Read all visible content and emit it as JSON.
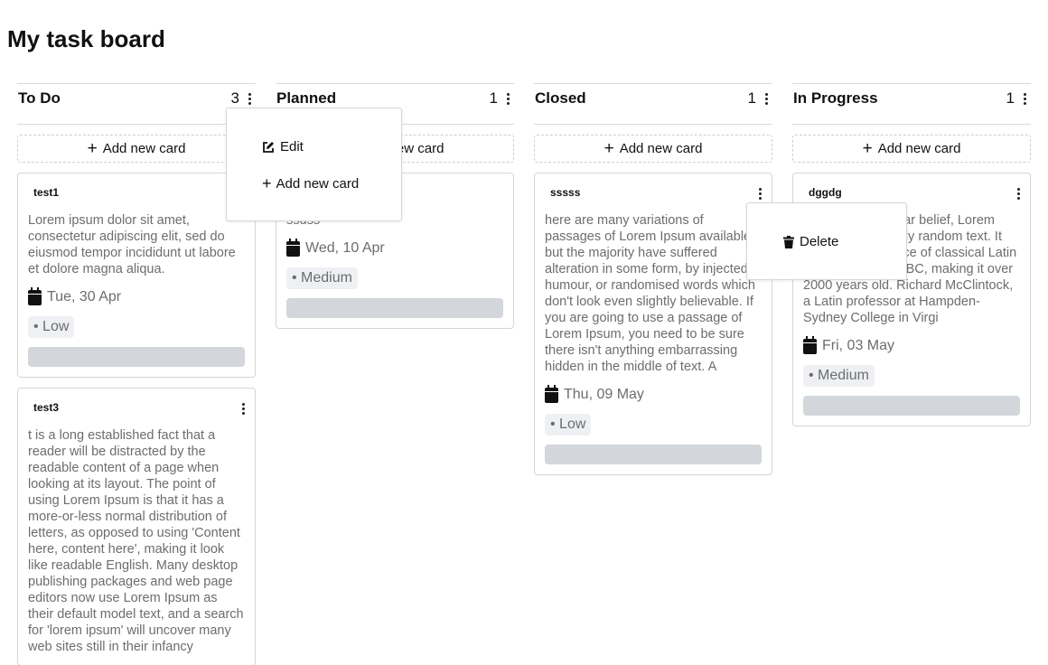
{
  "page": {
    "title": "My task board"
  },
  "columns": [
    {
      "title": "To Do",
      "count": "3",
      "add_label": "Add new card",
      "cards": [
        {
          "title": "test1",
          "description": "Lorem ipsum dolor sit amet, consectetur adipiscing elit, sed do eiusmod tempor incididunt ut labore et dolore magna aliqua.",
          "date": "Tue, 30 Apr",
          "priority": "• Low"
        },
        {
          "title": "test3",
          "description": "t is a long established fact that a reader will be distracted by the readable content of a page when looking at its layout. The point of using Lorem Ipsum is that it has a more-or-less normal distribution of letters, as opposed to using 'Content here, content here', making it look like readable English. Many desktop publishing packages and web page editors now use Lorem Ipsum as their default model text, and a search for 'lorem ipsum' will uncover many web sites still in their infancy"
        }
      ]
    },
    {
      "title": "Planned",
      "count": "1",
      "add_label": "Add new card",
      "cards": [
        {
          "title": "",
          "description": "ssdss",
          "date": "Wed, 10 Apr",
          "priority": "• Medium"
        }
      ]
    },
    {
      "title": "Closed",
      "count": "1",
      "add_label": "Add new card",
      "cards": [
        {
          "title": "sssss",
          "description": "here are many variations of passages of Lorem Ipsum available, but the majority have suffered alteration in some form, by injected humour, or randomised words which don't look even slightly believable. If you are going to use a passage of Lorem Ipsum, you need to be sure there isn't anything embarrassing hidden in the middle of text. A",
          "date": "Thu, 09 May",
          "priority": "• Low"
        }
      ]
    },
    {
      "title": "In Progress",
      "count": "1",
      "add_label": "Add new card",
      "cards": [
        {
          "title": "dggdg",
          "description": "Contrary to popular belief, Lorem Ipsum is not simply random text. It has roots in a piece of classical Latin literature from 45 BC, making it over 2000 years old. Richard McClintock, a Latin professor at Hampden-Sydney College in Virgi",
          "date": "Fri, 03 May",
          "priority": "• Medium"
        }
      ]
    }
  ],
  "column_menu": {
    "edit_label": "Edit",
    "add_label": "Add new card"
  },
  "card_menu": {
    "delete_label": "Delete"
  }
}
